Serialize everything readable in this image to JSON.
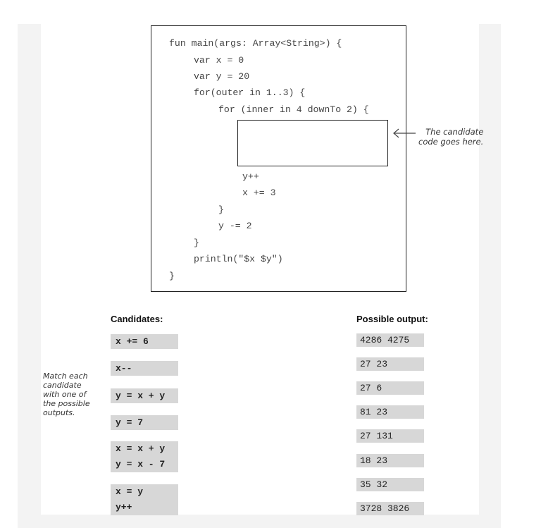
{
  "code": {
    "lines": [
      "fun main(args: Array<String>) {",
      "var x = 0",
      "var y = 20",
      "for(outer in 1..3) {",
      "for (inner in 4 downTo 2) {",
      "y++",
      "x += 3",
      "}",
      "y -= 2",
      "}",
      "println(\"$x $y\")",
      "}"
    ]
  },
  "annotations": {
    "slot_note": "The candidate\ncode goes here.",
    "match_note": "Match each\ncandidate\nwith one of\nthe possible\noutputs."
  },
  "candidates": {
    "heading": "Candidates:",
    "items": [
      "x += 6",
      "x--",
      "y = x + y",
      "y = 7",
      "x = x + y\ny = x - 7",
      "x = y\ny++"
    ]
  },
  "outputs": {
    "heading": "Possible output:",
    "items": [
      "4286 4275",
      "27 23",
      "27 6",
      "81 23",
      "27 131",
      "18 23",
      "35 32",
      "3728 3826"
    ]
  }
}
